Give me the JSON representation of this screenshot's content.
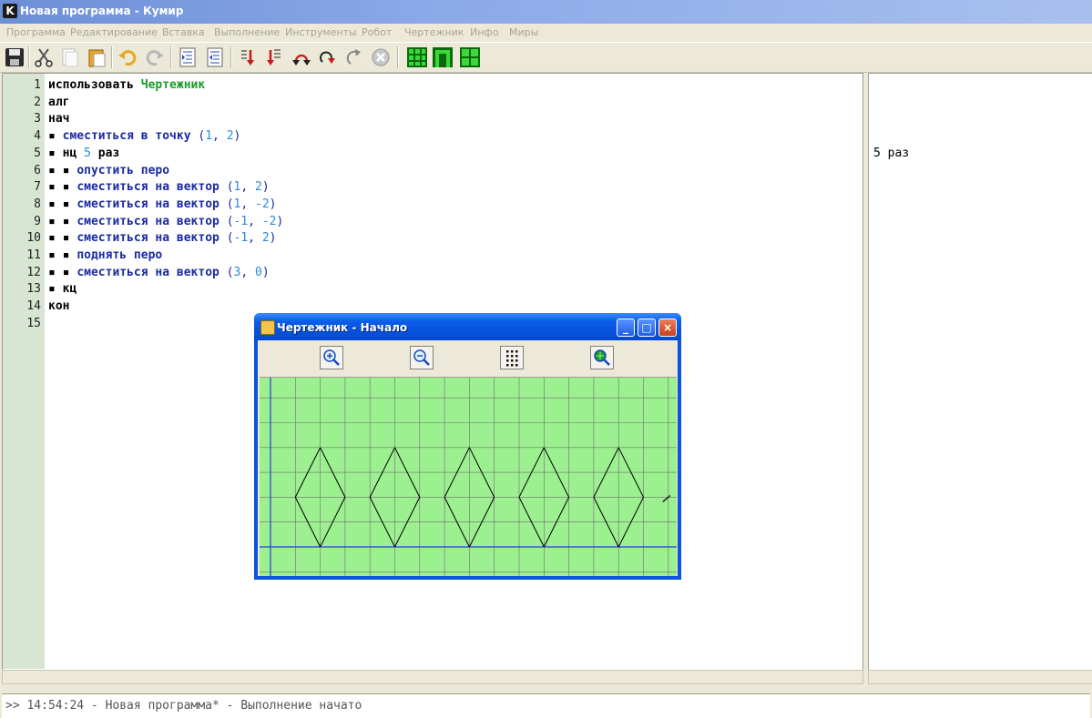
{
  "window": {
    "title": "Новая программа - Кумир",
    "icon_letter": "K"
  },
  "menu": [
    "Программа",
    "Редактирование",
    "Вставка",
    "Выполнение",
    "Инструменты",
    "Робот",
    "Чертежник",
    "Инфо",
    "Миры"
  ],
  "toolbar": {
    "icons": [
      "save-icon",
      "cut-icon",
      "copy-icon",
      "paste-icon",
      "undo-icon",
      "redo-icon",
      "indent-icon",
      "unindent-icon",
      "run-icon",
      "run-step-icon",
      "step-over-icon",
      "step-into-icon",
      "step-out-icon",
      "stop-icon",
      "robot-field-icon",
      "robot-window-icon",
      "drawer-window-icon"
    ],
    "accent": "#1a9b2a"
  },
  "editor": {
    "line_numbers": [
      "1",
      "2",
      "3",
      "4",
      "5",
      "6",
      "7",
      "8",
      "9",
      "10",
      "11",
      "12",
      "13",
      "14",
      "15"
    ],
    "lines": [
      [
        {
          "t": "использовать ",
          "c": "kw"
        },
        {
          "t": "Чертежник",
          "c": "mod"
        }
      ],
      [
        {
          "t": "алг",
          "c": "kw"
        }
      ],
      [
        {
          "t": "нач",
          "c": "kw"
        }
      ],
      [
        {
          "t": "▪ ",
          "c": "dot"
        },
        {
          "t": "сместиться в точку ",
          "c": "act"
        },
        {
          "t": "(",
          "c": "punct"
        },
        {
          "t": "1",
          "c": "num"
        },
        {
          "t": ", ",
          "c": "punct"
        },
        {
          "t": "2",
          "c": "num"
        },
        {
          "t": ")",
          "c": "punct"
        }
      ],
      [
        {
          "t": "▪ ",
          "c": "dot"
        },
        {
          "t": "нц ",
          "c": "kw"
        },
        {
          "t": "5",
          "c": "num"
        },
        {
          "t": " раз",
          "c": "kw"
        }
      ],
      [
        {
          "t": "▪ ▪ ",
          "c": "dot"
        },
        {
          "t": "опустить перо",
          "c": "act"
        }
      ],
      [
        {
          "t": "▪ ▪ ",
          "c": "dot"
        },
        {
          "t": "сместиться на вектор ",
          "c": "act"
        },
        {
          "t": "(",
          "c": "punct"
        },
        {
          "t": "1",
          "c": "num"
        },
        {
          "t": ", ",
          "c": "punct"
        },
        {
          "t": "2",
          "c": "num"
        },
        {
          "t": ")",
          "c": "punct"
        }
      ],
      [
        {
          "t": "▪ ▪ ",
          "c": "dot"
        },
        {
          "t": "сместиться на вектор ",
          "c": "act"
        },
        {
          "t": "(",
          "c": "punct"
        },
        {
          "t": "1",
          "c": "num"
        },
        {
          "t": ", ",
          "c": "punct"
        },
        {
          "t": "-2",
          "c": "num"
        },
        {
          "t": ")",
          "c": "punct"
        }
      ],
      [
        {
          "t": "▪ ▪ ",
          "c": "dot"
        },
        {
          "t": "сместиться на вектор ",
          "c": "act"
        },
        {
          "t": "(",
          "c": "punct"
        },
        {
          "t": "-1",
          "c": "num"
        },
        {
          "t": ", ",
          "c": "punct"
        },
        {
          "t": "-2",
          "c": "num"
        },
        {
          "t": ")",
          "c": "punct"
        }
      ],
      [
        {
          "t": "▪ ▪ ",
          "c": "dot"
        },
        {
          "t": "сместиться на вектор ",
          "c": "act"
        },
        {
          "t": "(",
          "c": "punct"
        },
        {
          "t": "-1",
          "c": "num"
        },
        {
          "t": ", ",
          "c": "punct"
        },
        {
          "t": "2",
          "c": "num"
        },
        {
          "t": ")",
          "c": "punct"
        }
      ],
      [
        {
          "t": "▪ ▪ ",
          "c": "dot"
        },
        {
          "t": "поднять перо",
          "c": "act"
        }
      ],
      [
        {
          "t": "▪ ▪ ",
          "c": "dot"
        },
        {
          "t": "сместиться на вектор ",
          "c": "act"
        },
        {
          "t": "(",
          "c": "punct"
        },
        {
          "t": "3",
          "c": "num"
        },
        {
          "t": ", ",
          "c": "punct"
        },
        {
          "t": "0",
          "c": "num"
        },
        {
          "t": ")",
          "c": "punct"
        }
      ],
      [
        {
          "t": "▪ ",
          "c": "dot"
        },
        {
          "t": "кц",
          "c": "kw"
        }
      ],
      [
        {
          "t": "кон",
          "c": "kw"
        }
      ],
      []
    ]
  },
  "margin": {
    "text": "5 раз"
  },
  "console": {
    "text": ">> 14:54:24 - Новая программа* - Выполнение начато"
  },
  "drawer": {
    "title": "Чертежник - Начало",
    "buttons": [
      "zoom-in-icon",
      "zoom-out-icon",
      "grid-icon",
      "fit-icon"
    ],
    "canvas_color": "#9cf090",
    "grid_color": "#6f6f6f",
    "axis_color": "#2a3ad8",
    "diamonds": 5,
    "drawing": [
      {
        "from": [
          1,
          2
        ],
        "to": [
          2,
          4
        ]
      },
      {
        "from": [
          2,
          4
        ],
        "to": [
          3,
          2
        ]
      },
      {
        "from": [
          3,
          2
        ],
        "to": [
          2,
          0
        ]
      },
      {
        "from": [
          2,
          0
        ],
        "to": [
          1,
          2
        ]
      },
      {
        "from": [
          4,
          2
        ],
        "to": [
          5,
          4
        ]
      },
      {
        "from": [
          5,
          4
        ],
        "to": [
          6,
          2
        ]
      },
      {
        "from": [
          6,
          2
        ],
        "to": [
          5,
          0
        ]
      },
      {
        "from": [
          5,
          0
        ],
        "to": [
          4,
          2
        ]
      },
      {
        "from": [
          7,
          2
        ],
        "to": [
          8,
          4
        ]
      },
      {
        "from": [
          8,
          4
        ],
        "to": [
          9,
          2
        ]
      },
      {
        "from": [
          9,
          2
        ],
        "to": [
          8,
          0
        ]
      },
      {
        "from": [
          8,
          0
        ],
        "to": [
          7,
          2
        ]
      },
      {
        "from": [
          10,
          2
        ],
        "to": [
          11,
          4
        ]
      },
      {
        "from": [
          11,
          4
        ],
        "to": [
          12,
          2
        ]
      },
      {
        "from": [
          12,
          2
        ],
        "to": [
          11,
          0
        ]
      },
      {
        "from": [
          11,
          0
        ],
        "to": [
          10,
          2
        ]
      },
      {
        "from": [
          13,
          2
        ],
        "to": [
          14,
          4
        ]
      },
      {
        "from": [
          14,
          4
        ],
        "to": [
          15,
          2
        ]
      },
      {
        "from": [
          15,
          2
        ],
        "to": [
          14,
          0
        ]
      },
      {
        "from": [
          14,
          0
        ],
        "to": [
          13,
          2
        ]
      }
    ],
    "pen_position": [
      16,
      2
    ]
  }
}
